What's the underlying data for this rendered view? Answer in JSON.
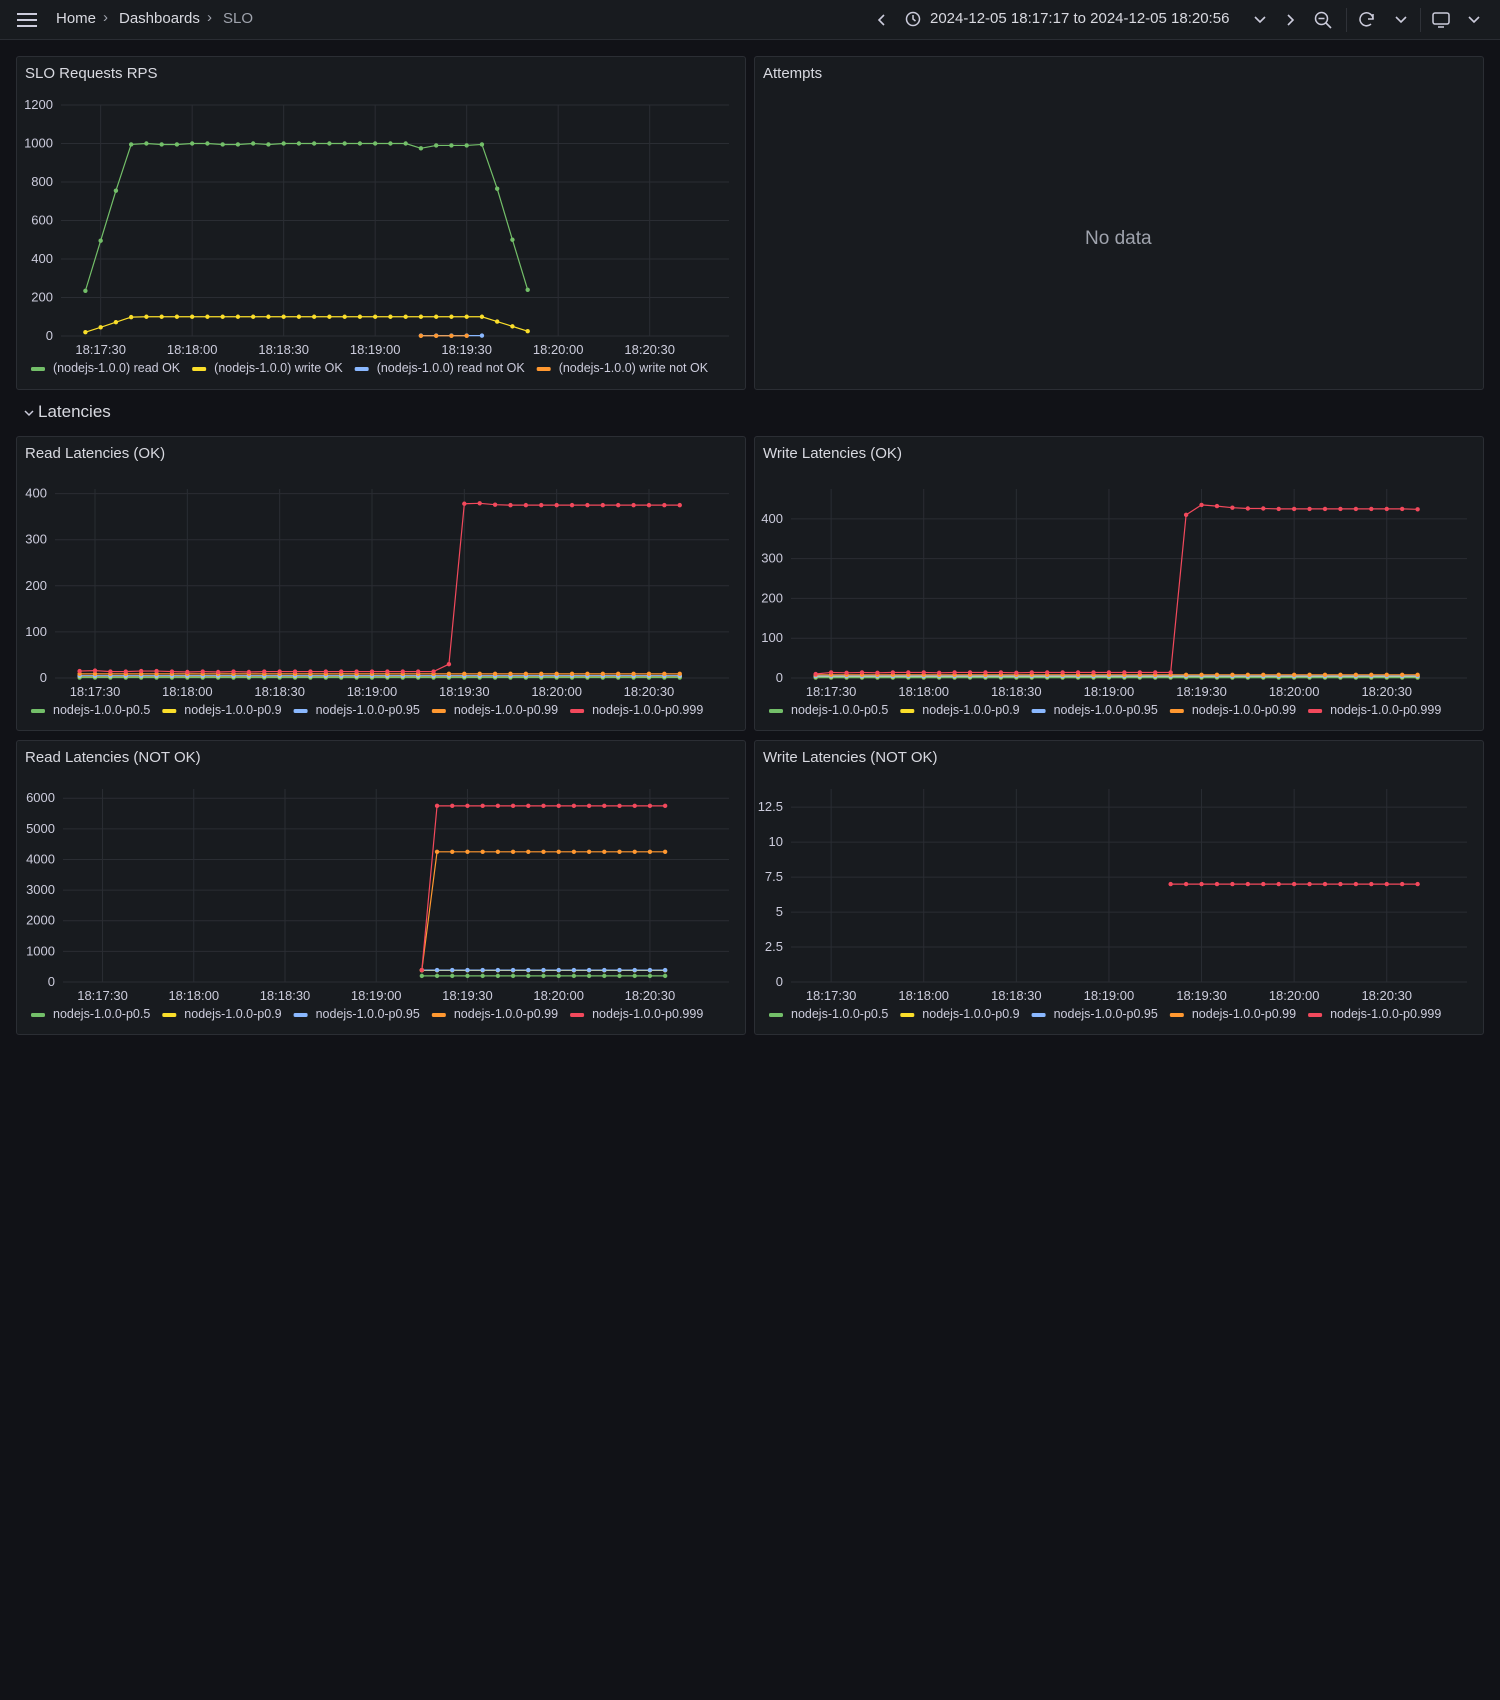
{
  "breadcrumb": [
    "Home",
    "Dashboards",
    "SLO"
  ],
  "time_range": "2024-12-05 18:17:17 to 2024-12-05 18:20:56",
  "icons": [
    "menu-icon",
    "chevron-right-icon",
    "chevron-left-icon",
    "clock-icon",
    "chevron-down-icon",
    "zoom-out-icon",
    "refresh-icon",
    "tv-mode-icon"
  ],
  "colors": {
    "green": "#73bf69",
    "yellow": "#fade2a",
    "blue": "#8ab8ff",
    "orange": "#ff9830",
    "red": "#f2495c"
  },
  "row_latencies": "Latencies",
  "panels": {
    "slo_rps": {
      "title": "SLO Requests RPS",
      "legend": [
        "(nodejs-1.0.0) read OK",
        "(nodejs-1.0.0) write OK",
        "(nodejs-1.0.0) read not OK",
        "(nodejs-1.0.0) write not OK"
      ]
    },
    "attempts": {
      "title": "Attempts",
      "no_data": "No data"
    },
    "read_ok": {
      "title": "Read Latencies (OK)",
      "legend": [
        "nodejs-1.0.0-p0.5",
        "nodejs-1.0.0-p0.9",
        "nodejs-1.0.0-p0.95",
        "nodejs-1.0.0-p0.99",
        "nodejs-1.0.0-p0.999"
      ]
    },
    "write_ok": {
      "title": "Write Latencies (OK)",
      "legend": [
        "nodejs-1.0.0-p0.5",
        "nodejs-1.0.0-p0.9",
        "nodejs-1.0.0-p0.95",
        "nodejs-1.0.0-p0.99",
        "nodejs-1.0.0-p0.999"
      ]
    },
    "read_nok": {
      "title": "Read Latencies (NOT OK)",
      "legend": [
        "nodejs-1.0.0-p0.5",
        "nodejs-1.0.0-p0.9",
        "nodejs-1.0.0-p0.95",
        "nodejs-1.0.0-p0.99",
        "nodejs-1.0.0-p0.999"
      ]
    },
    "write_nok": {
      "title": "Write Latencies (NOT OK)",
      "legend": [
        "nodejs-1.0.0-p0.5",
        "nodejs-1.0.0-p0.9",
        "nodejs-1.0.0-p0.95",
        "nodejs-1.0.0-p0.99",
        "nodejs-1.0.0-p0.999"
      ]
    }
  },
  "chart_data": [
    {
      "id": "slo_rps",
      "type": "line",
      "x_range": [
        "18:17:17",
        "18:20:56"
      ],
      "x_ticks": [
        "18:17:30",
        "18:18:00",
        "18:18:30",
        "18:19:00",
        "18:19:30",
        "18:20:00",
        "18:20:30"
      ],
      "y_ticks": [
        0,
        200,
        400,
        600,
        800,
        1000,
        1200
      ],
      "ylim": [
        0,
        1200
      ],
      "grid": true,
      "legend": "bottom",
      "series": [
        {
          "name": "(nodejs-1.0.0) read OK",
          "color": "green",
          "x": [
            "18:17:25",
            "18:17:30",
            "18:17:35",
            "18:17:40",
            "18:17:45",
            "18:17:50",
            "18:17:55",
            "18:18:00",
            "18:18:05",
            "18:18:10",
            "18:18:15",
            "18:18:20",
            "18:18:25",
            "18:18:30",
            "18:18:35",
            "18:18:40",
            "18:18:45",
            "18:18:50",
            "18:18:55",
            "18:19:00",
            "18:19:05",
            "18:19:10",
            "18:19:15",
            "18:19:20",
            "18:19:25",
            "18:19:30",
            "18:19:35",
            "18:19:40",
            "18:19:45",
            "18:19:50",
            "18:19:55"
          ],
          "y": [
            235,
            495,
            755,
            995,
            1000,
            995,
            995,
            1000,
            1000,
            995,
            995,
            1000,
            995,
            1000,
            1000,
            1000,
            1000,
            1000,
            1000,
            1000,
            1000,
            1000,
            975,
            990,
            990,
            990,
            995,
            765,
            500,
            240,
            null
          ]
        },
        {
          "name": "(nodejs-1.0.0) write OK",
          "color": "yellow",
          "x": [
            "18:17:25",
            "18:17:30",
            "18:17:35",
            "18:17:40",
            "18:17:45",
            "18:17:50",
            "18:17:55",
            "18:18:00",
            "18:18:05",
            "18:18:10",
            "18:18:15",
            "18:18:20",
            "18:18:25",
            "18:18:30",
            "18:18:35",
            "18:18:40",
            "18:18:45",
            "18:18:50",
            "18:18:55",
            "18:19:00",
            "18:19:05",
            "18:19:10",
            "18:19:15",
            "18:19:20",
            "18:19:25",
            "18:19:30",
            "18:19:35",
            "18:19:40",
            "18:19:45",
            "18:19:50"
          ],
          "y": [
            20,
            45,
            72,
            98,
            100,
            100,
            100,
            100,
            100,
            100,
            100,
            100,
            100,
            100,
            100,
            100,
            100,
            100,
            100,
            100,
            100,
            100,
            100,
            100,
            100,
            100,
            100,
            75,
            50,
            25
          ]
        },
        {
          "name": "(nodejs-1.0.0) read not OK",
          "color": "blue",
          "x": [
            "18:19:15",
            "18:19:20",
            "18:19:25",
            "18:19:30",
            "18:19:35"
          ],
          "y": [
            2,
            2,
            2,
            2,
            2
          ]
        },
        {
          "name": "(nodejs-1.0.0) write not OK",
          "color": "orange",
          "x": [
            "18:19:15",
            "18:19:20",
            "18:19:25",
            "18:19:30"
          ],
          "y": [
            1,
            1,
            1,
            1
          ]
        }
      ]
    },
    {
      "id": "read_ok",
      "type": "line",
      "x_range": [
        "18:17:17",
        "18:20:56"
      ],
      "x_ticks": [
        "18:17:30",
        "18:18:00",
        "18:18:30",
        "18:19:00",
        "18:19:30",
        "18:20:00",
        "18:20:30"
      ],
      "y_ticks": [
        0,
        100,
        200,
        300,
        400
      ],
      "ylim": [
        0,
        410
      ],
      "grid": true,
      "legend": "bottom",
      "x_start": "18:17:25",
      "x_step_s": 5,
      "n": 40,
      "series": [
        {
          "name": "nodejs-1.0.0-p0.5",
          "color": "green",
          "y_flat": [
            [
              0,
              40,
              1
            ]
          ]
        },
        {
          "name": "nodejs-1.0.0-p0.9",
          "color": "yellow",
          "y_flat": [
            [
              0,
              40,
              4
            ]
          ]
        },
        {
          "name": "nodejs-1.0.0-p0.95",
          "color": "blue",
          "y_flat": [
            [
              0,
              40,
              5
            ]
          ]
        },
        {
          "name": "nodejs-1.0.0-p0.99",
          "color": "orange",
          "y_flat": [
            [
              0,
              40,
              9
            ]
          ]
        },
        {
          "name": "nodejs-1.0.0-p0.999",
          "color": "red",
          "y": [
            15,
            16,
            14,
            14,
            15,
            15,
            14,
            13,
            14,
            13,
            14,
            13,
            14,
            14,
            14,
            14,
            14,
            14,
            14,
            14,
            14,
            14,
            14,
            14,
            30,
            378,
            379,
            376,
            375,
            375,
            375,
            375,
            375,
            375,
            375,
            375,
            375,
            375,
            375,
            375
          ]
        }
      ]
    },
    {
      "id": "write_ok",
      "type": "line",
      "x_range": [
        "18:17:17",
        "18:20:56"
      ],
      "x_ticks": [
        "18:17:30",
        "18:18:00",
        "18:18:30",
        "18:19:00",
        "18:19:30",
        "18:20:00",
        "18:20:30"
      ],
      "y_ticks": [
        0,
        100,
        200,
        300,
        400
      ],
      "ylim": [
        0,
        475
      ],
      "grid": true,
      "legend": "bottom",
      "x_start": "18:17:25",
      "x_step_s": 5,
      "n": 40,
      "series": [
        {
          "name": "nodejs-1.0.0-p0.5",
          "color": "green",
          "y_flat": [
            [
              0,
              40,
              1
            ]
          ]
        },
        {
          "name": "nodejs-1.0.0-p0.9",
          "color": "yellow",
          "y_flat": [
            [
              0,
              40,
              4
            ]
          ]
        },
        {
          "name": "nodejs-1.0.0-p0.95",
          "color": "blue",
          "y_flat": [
            [
              0,
              40,
              5
            ]
          ]
        },
        {
          "name": "nodejs-1.0.0-p0.99",
          "color": "orange",
          "y_flat": [
            [
              0,
              40,
              8
            ]
          ]
        },
        {
          "name": "nodejs-1.0.0-p0.999",
          "color": "red",
          "y": [
            10,
            14,
            13,
            14,
            13,
            14,
            14,
            14,
            13,
            14,
            14,
            14,
            14,
            13,
            14,
            14,
            14,
            14,
            14,
            14,
            14,
            14,
            14,
            14,
            410,
            435,
            432,
            428,
            426,
            426,
            425,
            425,
            425,
            425,
            425,
            425,
            425,
            425,
            425,
            424
          ]
        }
      ]
    },
    {
      "id": "read_nok",
      "type": "line",
      "x_range": [
        "18:17:17",
        "18:20:56"
      ],
      "x_ticks": [
        "18:17:30",
        "18:18:00",
        "18:18:30",
        "18:19:00",
        "18:19:30",
        "18:20:00",
        "18:20:30"
      ],
      "y_ticks": [
        0,
        1000,
        2000,
        3000,
        4000,
        5000,
        6000
      ],
      "ylim": [
        0,
        6300
      ],
      "grid": true,
      "legend": "bottom",
      "x_start": "18:19:15",
      "x_step_s": 5,
      "n": 17,
      "series": [
        {
          "name": "nodejs-1.0.0-p0.5",
          "color": "green",
          "y_flat": [
            [
              0,
              17,
              200
            ]
          ]
        },
        {
          "name": "nodejs-1.0.0-p0.9",
          "color": "yellow",
          "y_flat": [
            [
              0,
              17,
              380
            ]
          ]
        },
        {
          "name": "nodejs-1.0.0-p0.95",
          "color": "blue",
          "y_flat": [
            [
              0,
              17,
              390
            ]
          ]
        },
        {
          "name": "nodejs-1.0.0-p0.99",
          "color": "orange",
          "y": [
            390,
            4250,
            4250,
            4250,
            4250,
            4250,
            4250,
            4250,
            4250,
            4250,
            4250,
            4250,
            4250,
            4250,
            4250,
            4250,
            4250
          ]
        },
        {
          "name": "nodejs-1.0.0-p0.999",
          "color": "red",
          "y": [
            390,
            5750,
            5750,
            5750,
            5750,
            5750,
            5750,
            5750,
            5750,
            5750,
            5750,
            5750,
            5750,
            5750,
            5750,
            5750,
            5750
          ]
        }
      ]
    },
    {
      "id": "write_nok",
      "type": "line",
      "x_range": [
        "18:17:17",
        "18:20:56"
      ],
      "x_ticks": [
        "18:17:30",
        "18:18:00",
        "18:18:30",
        "18:19:00",
        "18:19:30",
        "18:20:00",
        "18:20:30"
      ],
      "y_ticks": [
        0,
        2.5,
        5,
        7.5,
        10,
        12.5
      ],
      "ylim": [
        0,
        13.8
      ],
      "grid": true,
      "legend": "bottom",
      "x_start": "18:19:20",
      "x_step_s": 5,
      "n": 17,
      "series": [
        {
          "name": "nodejs-1.0.0-p0.999",
          "color": "red",
          "y_flat": [
            [
              0,
              17,
              7
            ]
          ]
        }
      ]
    }
  ]
}
